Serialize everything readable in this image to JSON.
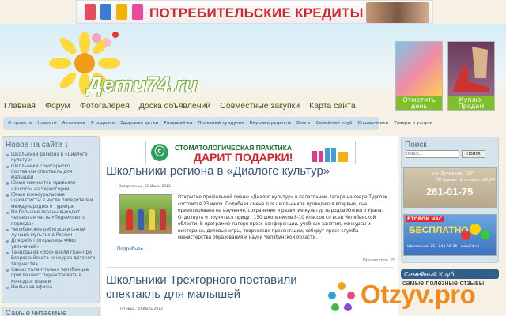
{
  "top_banner": {
    "text": "ПОТРЕБИТЕЛЬСКИЕ КРЕДИТЫ"
  },
  "site": {
    "logo": "Дети74.ru"
  },
  "header_ads": [
    {
      "caption": "Отметить день рождения?!"
    },
    {
      "caption": "Куплю-Продам"
    }
  ],
  "main_nav": [
    "Главная",
    "Форум",
    "Фотогалерея",
    "Доска объявлений",
    "Совместные закупки",
    "Карта сайта"
  ],
  "sub_nav": [
    "О проекте",
    "Новости",
    "Автомама",
    "Я родился",
    "Здоровые детки",
    "Развивай-ка",
    "Полезный сундучок",
    "Вкусные рецепты",
    "Блоги",
    "Семейный клуб",
    "Справочники",
    "Товары и услуги"
  ],
  "left_sidebar": {
    "title": "Новое на сайте ↓",
    "items": [
      "Школьники региона в «Диалоге культур»",
      "Школьники Трехгорного поставили спектакль для малышей",
      "Юные гимнастки привезли «золото» из Черногории",
      "Юные южноуральские шахматисты в числе победителей международного турнира",
      "На большие экраны выходит четвертая часть «Ледникового периода»",
      "Челябинские ребятишки сняли лучший мультик в России",
      "Для ребят открылась «Мир увлечений»",
      "Танцоры из «Эхо» взяли гран-при Всероссийского конкурса детского творчества",
      "Самых талантливых челябинцев приглашают поучаствовать в конкурсе поэзии",
      "Июльская афиша"
    ],
    "second_title": "Самые читаемые"
  },
  "content_ad": {
    "line1": "СТОМАТОЛОГИЧЕСКАЯ ПРАКТИКА",
    "line2": "ДАРИТ ПОДАРКИ!"
  },
  "articles": [
    {
      "title": "Школьники региона в «Диалоге культур»",
      "date": "Воскресенье, 22 Июль 2012",
      "body": "Открытие профильной смены «Диалог культур» в палаточном лагере на озере Тургояк состоится 23 июля. Подобная смена для школьников проводится впервые, она ориентирована на изучение, сохранение и развитие культур народов Южного Урала. Отдохнуть и поучиться придут 150 школьников 8-10 классов со всей Челябинской области. В программе лагеря пресс-конференции, учебные занятия, конкурсы и викторины, деловые игры, творческие презентации, соберут пресс-служба министерства образования и науки Челябинской области.",
      "more": "Подробнее...",
      "views": "Просмотров: 79"
    },
    {
      "title": "Школьники Трехгорного поставили спектакль для малышей",
      "date": "Пятница, 20 Июль 2012"
    }
  ],
  "right_sidebar": {
    "search_title": "Поиск",
    "search_placeholder": "поиск...",
    "search_button": "Поиск",
    "ad1": {
      "line1": "ул. Энгельса, 107",
      "line2": "РК Ермак (1 этаж) с 12:00",
      "phone": "261-01-75"
    },
    "ad2": {
      "badge": "ВТОРОЙ ЧАС",
      "big": "БЕСПЛАТНО",
      "addr": "Цвиллинга, 25 · 243-26-26 · cuba74.ru"
    },
    "family_title": "Семейный Клуб",
    "family_sub": "самые полезные отзывы"
  },
  "watermark": {
    "text": "Otzyv.pro"
  },
  "colors": {
    "nav_green": "#3c5a18",
    "link_blue": "#38567a",
    "ad_red": "#d5232a",
    "watermark_orange": "#f28a1c"
  }
}
